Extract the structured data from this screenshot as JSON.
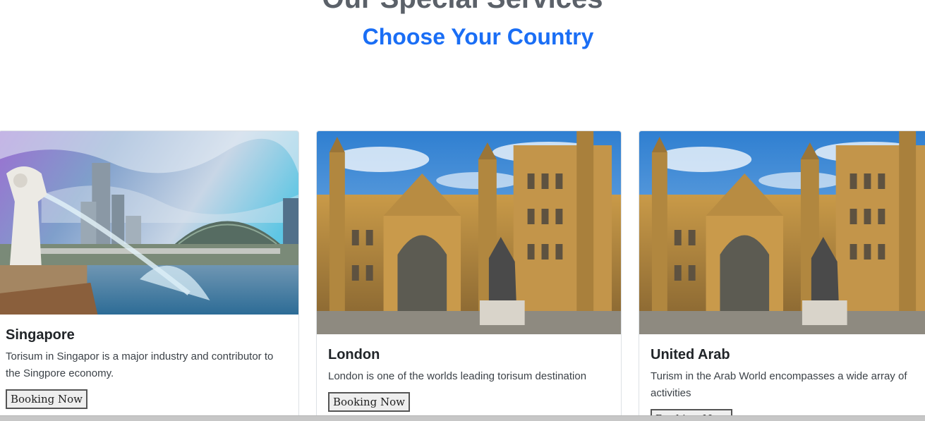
{
  "heading": {
    "title": "Our Special Services",
    "subtitle": "Choose Your Country"
  },
  "cards": [
    {
      "title": "Singapore",
      "text": "Torisum in Singapor is a major industry and contributor to the Singpore economy.",
      "button": "Booking Now",
      "image_icon": "singapore-merlion-skyline-photo"
    },
    {
      "title": "London",
      "text": "London is one of the worlds leading torisum destination",
      "button": "Booking Now",
      "image_icon": "london-parliament-photo"
    },
    {
      "title": "United Arab",
      "text": "Turism in the Arab World encompasses a wide array of activities",
      "button": "Booking Now",
      "image_icon": "london-parliament-photo"
    }
  ],
  "colors": {
    "subtitle": "#1a6ef5",
    "title": "#5b6169"
  }
}
